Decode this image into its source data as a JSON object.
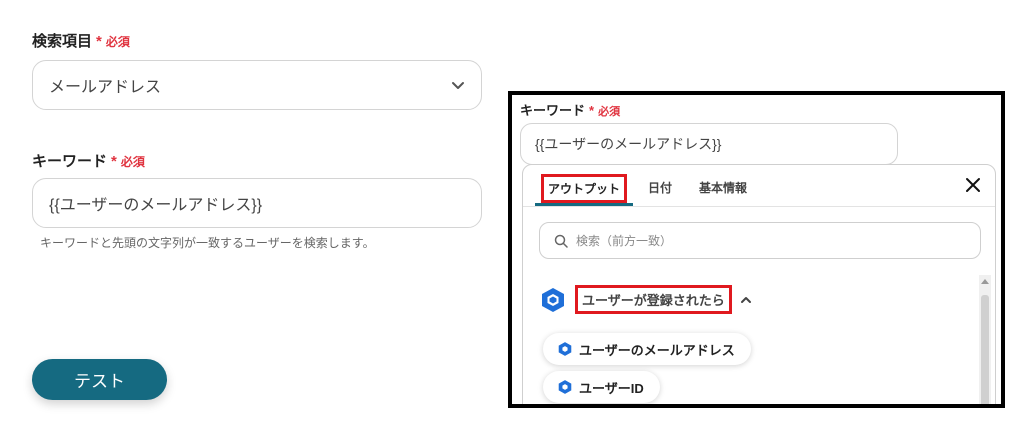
{
  "left": {
    "search_item": {
      "label": "検索項目",
      "required_star": "*",
      "required_text": "必須",
      "selected_value": "メールアドレス"
    },
    "keyword": {
      "label": "キーワード",
      "required_star": "*",
      "required_text": "必須",
      "value": "{{ユーザーのメールアドレス}}",
      "hint": "キーワードと先頭の文字列が一致するユーザーを検索します。"
    },
    "test_button": "テスト"
  },
  "panel": {
    "keyword_label": "キーワード",
    "required_star": "*",
    "required_text": "必須",
    "keyword_value": "{{ユーザーのメールアドレス}}",
    "tabs": [
      {
        "label": "アウトプット"
      },
      {
        "label": "日付"
      },
      {
        "label": "基本情報"
      }
    ],
    "search_placeholder": "検索（前方一致）",
    "group_label": "ユーザーが登録されたら",
    "items": [
      {
        "label": "ユーザーのメールアドレス"
      },
      {
        "label": "ユーザーID"
      }
    ]
  },
  "colors": {
    "accent": "#156a81",
    "required": "#e0333f",
    "highlight_box": "#e0191f",
    "app_icon": "#1f6fd8"
  },
  "icons": [
    "chevron-down-icon",
    "close-icon",
    "search-icon",
    "app-hexagon-icon",
    "chevron-up-icon"
  ]
}
